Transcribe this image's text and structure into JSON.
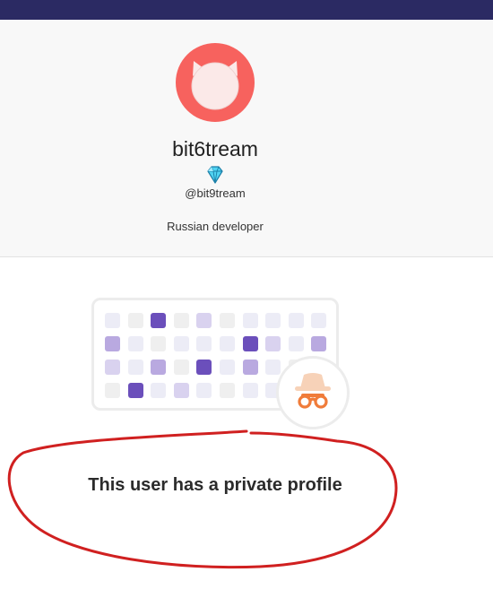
{
  "profile": {
    "display_name": "bit6tream",
    "badge_icon": "diamond-icon",
    "handle": "@bit9tream",
    "bio": "Russian developer",
    "avatar_color": "#f7625e"
  },
  "private_notice": {
    "message": "This user has a private profile",
    "icon": "incognito-spy-icon",
    "accent_color": "#6b4fbb",
    "spy_color": "#f07c3a"
  },
  "annotation": {
    "stroke_color": "#d02020"
  }
}
